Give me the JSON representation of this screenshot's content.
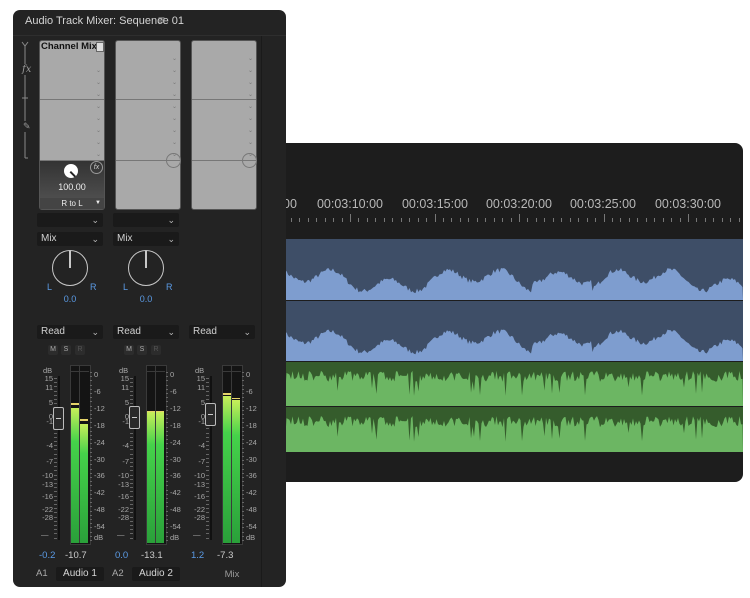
{
  "timeline": {
    "ruler_labels": [
      "00",
      "00:03:10:00",
      "00:03:15:00",
      "00:03:20:00",
      "00:03:25:00",
      "00:03:30:00"
    ],
    "tracks": [
      {
        "name": "Audio 1",
        "color_bg": "#3e4e67",
        "color_wave": "#7e9dcf"
      },
      {
        "name": "Audio 2",
        "color_bg": "#355c2c",
        "color_wave": "#6cb663"
      }
    ]
  },
  "mixer": {
    "title": "Audio Track Mixer: Sequence 01",
    "menu_icon": "≡",
    "fx_label": "fx",
    "effect_name": "Channel Mixe",
    "effect_value": "100.00",
    "effect_param": "R to L",
    "fader_scale": [
      "dB",
      "15",
      "11",
      "5",
      "0",
      "-1",
      "-4",
      "-7",
      "-10",
      "-13",
      "-16",
      "-22",
      "-28",
      "—"
    ],
    "meter_scale": [
      "0",
      "-6",
      "-12",
      "-18",
      "-24",
      "-30",
      "-36",
      "-42",
      "-48",
      "-54",
      "dB"
    ],
    "channels": [
      {
        "id": "A1",
        "name": "Audio 1",
        "send": "Mix",
        "pan_l": "L",
        "pan_r": "R",
        "pan": "0.0",
        "automation": "Read",
        "mute": "M",
        "solo": "S",
        "record": "R",
        "fader": "-0.2",
        "fader_db": -0.2,
        "peak": "-10.7",
        "meter_left_db": -11.7,
        "meter_right_db": -17.4,
        "peak_left_db": -10.4,
        "peak_right_db": -16
      },
      {
        "id": "A2",
        "name": "Audio 2",
        "send": "Mix",
        "pan_l": "L",
        "pan_r": "R",
        "pan": "0.0",
        "automation": "Read",
        "mute": "M",
        "solo": "S",
        "record": "R",
        "fader": "0.0",
        "fader_db": 0.0,
        "peak": "-13.1",
        "meter_left_db": -13.1,
        "meter_right_db": -13.1,
        "peak_left_db": -13.1,
        "peak_right_db": -13.1
      },
      {
        "id": "",
        "name": "Mix",
        "automation": "Read",
        "fader": "1.2",
        "fader_db": 1.2,
        "peak": "-7.3",
        "meter_left_db": -7.5,
        "meter_right_db": -8.9,
        "peak_left_db": -6.8,
        "peak_right_db": -8.4
      }
    ]
  }
}
